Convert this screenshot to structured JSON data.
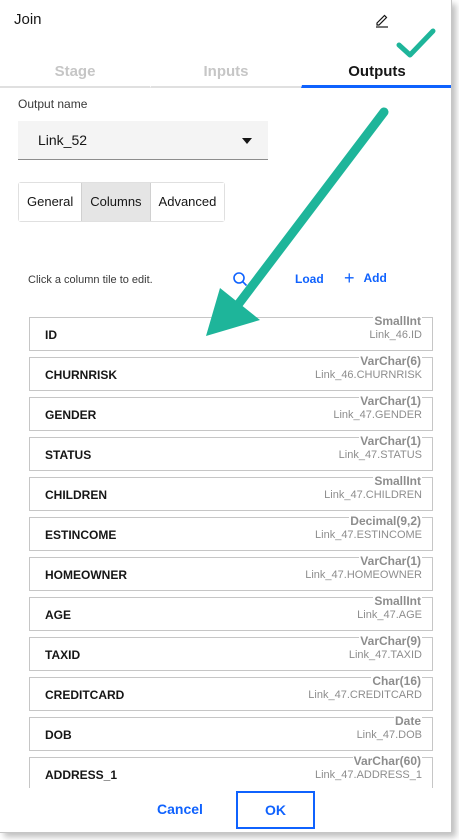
{
  "window": {
    "title": "Join"
  },
  "stage_tabs": [
    {
      "label": "Stage",
      "active": false
    },
    {
      "label": "Inputs",
      "active": false
    },
    {
      "label": "Outputs",
      "active": true
    }
  ],
  "output": {
    "label": "Output name",
    "selected": "Link_52"
  },
  "sub_tabs": [
    {
      "label": "General",
      "active": false
    },
    {
      "label": "Columns",
      "active": true
    },
    {
      "label": "Advanced",
      "active": false
    }
  ],
  "columns_toolbar": {
    "hint": "Click a column tile to edit.",
    "load_label": "Load",
    "add_label": "Add"
  },
  "columns": [
    {
      "name": "ID",
      "type": "SmallInt",
      "source": "Link_46.ID"
    },
    {
      "name": "CHURNRISK",
      "type": "VarChar(6)",
      "source": "Link_46.CHURNRISK"
    },
    {
      "name": "GENDER",
      "type": "VarChar(1)",
      "source": "Link_47.GENDER"
    },
    {
      "name": "STATUS",
      "type": "VarChar(1)",
      "source": "Link_47.STATUS"
    },
    {
      "name": "CHILDREN",
      "type": "SmallInt",
      "source": "Link_47.CHILDREN"
    },
    {
      "name": "ESTINCOME",
      "type": "Decimal(9,2)",
      "source": "Link_47.ESTINCOME"
    },
    {
      "name": "HOMEOWNER",
      "type": "VarChar(1)",
      "source": "Link_47.HOMEOWNER"
    },
    {
      "name": "AGE",
      "type": "SmallInt",
      "source": "Link_47.AGE"
    },
    {
      "name": "TAXID",
      "type": "VarChar(9)",
      "source": "Link_47.TAXID"
    },
    {
      "name": "CREDITCARD",
      "type": "Char(16)",
      "source": "Link_47.CREDITCARD"
    },
    {
      "name": "DOB",
      "type": "Date",
      "source": "Link_47.DOB"
    },
    {
      "name": "ADDRESS_1",
      "type": "VarChar(60)",
      "source": "Link_47.ADDRESS_1"
    }
  ],
  "footer": {
    "cancel_label": "Cancel",
    "ok_label": "OK"
  },
  "colors": {
    "accent": "#0f62fe",
    "annotation": "#1eb59a"
  },
  "icons": {
    "edit": "pencil-icon",
    "search": "search-icon",
    "add": "plus-icon",
    "caret": "chevron-down-icon"
  }
}
